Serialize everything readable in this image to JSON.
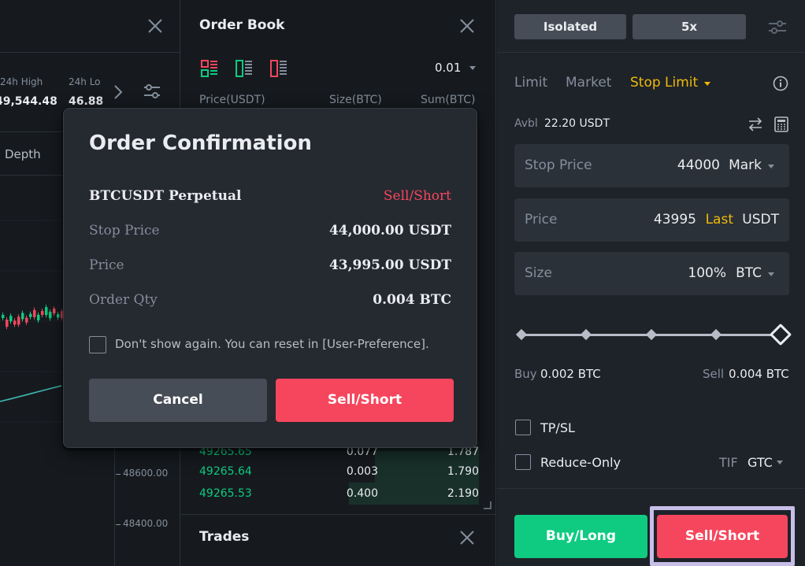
{
  "chart": {
    "stats": [
      {
        "label": "24h High",
        "value": "49,544.48"
      },
      {
        "label": "24h Lo",
        "value": "46.88"
      }
    ],
    "depth_tab": "Depth",
    "price_ticks": [
      "48600.00",
      "48400.00"
    ],
    "candles": [
      {
        "color": "green"
      },
      {
        "color": "red"
      },
      {
        "color": "green"
      },
      {
        "color": "red"
      },
      {
        "color": "red"
      },
      {
        "color": "green"
      },
      {
        "color": "red"
      },
      {
        "color": "green"
      },
      {
        "color": "red"
      },
      {
        "color": "green"
      },
      {
        "color": "red"
      },
      {
        "color": "green"
      },
      {
        "color": "green"
      },
      {
        "color": "red"
      },
      {
        "color": "green"
      },
      {
        "color": "red"
      }
    ]
  },
  "order_book": {
    "title": "Order Book",
    "precision": "0.01",
    "headers": {
      "price": "Price(USDT)",
      "size": "Size(BTC)",
      "sum": "Sum(BTC)"
    },
    "rows": [
      {
        "price": "49265.65",
        "size": "0.077",
        "sum": "1.787",
        "depth": 0.37
      },
      {
        "price": "49265.64",
        "size": "0.003",
        "sum": "1.790",
        "depth": 0.37
      },
      {
        "price": "49265.53",
        "size": "0.400",
        "sum": "2.190",
        "depth": 0.46
      }
    ],
    "trades_title": "Trades"
  },
  "order_form": {
    "margin_mode": "Isolated",
    "leverage": "5x",
    "tabs": [
      "Limit",
      "Market",
      "Stop Limit"
    ],
    "avbl_label": "Avbl",
    "avbl_value": "22.20 USDT",
    "stop_price": {
      "label": "Stop Price",
      "value": "44000",
      "unit": "Mark"
    },
    "price": {
      "label": "Price",
      "value": "43995",
      "tag": "Last",
      "unit": "USDT"
    },
    "size": {
      "label": "Size",
      "value": "100%",
      "unit": "BTC"
    },
    "slider_percent": 100,
    "buy_label": "Buy",
    "buy_value": "0.002 BTC",
    "sell_label": "Sell",
    "sell_value": "0.004 BTC",
    "tpsl_label": "TP/SL",
    "reduce_only_label": "Reduce-Only",
    "tif_label": "TIF",
    "tif_value": "GTC",
    "buy_button": "Buy/Long",
    "sell_button": "Sell/Short"
  },
  "modal": {
    "title": "Order Confirmation",
    "symbol": "BTCUSDT Perpetual",
    "side": "Sell/Short",
    "rows": [
      {
        "label": "Stop Price",
        "value": "44,000.00 USDT"
      },
      {
        "label": "Price",
        "value": "43,995.00 USDT"
      },
      {
        "label": "Order Qty",
        "value": "0.004 BTC"
      }
    ],
    "dont_show": "Don't show again. You can reset in [User-Preference].",
    "cancel": "Cancel",
    "confirm": "Sell/Short"
  },
  "colors": {
    "up": "#0ecb81",
    "down": "#f6465d",
    "accent": "#f0b90b",
    "line": "#3fb8b0"
  }
}
